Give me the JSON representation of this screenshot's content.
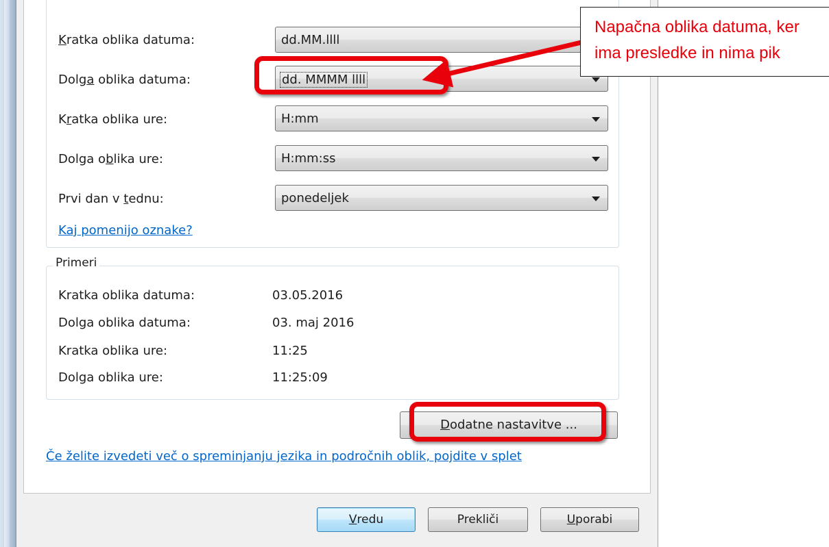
{
  "settings": {
    "rows": [
      {
        "label_pre": "",
        "label_key": "K",
        "label_post": "ratka oblika datuma:",
        "value": "dd.MM.llll"
      },
      {
        "label_pre": "Dolg",
        "label_key": "a",
        "label_post": " oblika datuma:",
        "value": "dd. MMMM llll"
      },
      {
        "label_pre": "K",
        "label_key": "r",
        "label_post": "atka oblika ure:",
        "value": "H:mm"
      },
      {
        "label_pre": "Dolga o",
        "label_key": "b",
        "label_post": "lika ure:",
        "value": "H:mm:ss"
      },
      {
        "label_pre": "Prvi dan v ",
        "label_key": "t",
        "label_post": "ednu:",
        "value": "ponedeljek"
      }
    ],
    "help_link": "Kaj pomenijo oznake?"
  },
  "examples": {
    "legend": "Primeri",
    "rows": [
      {
        "label": "Kratka oblika datuma:",
        "value": "03.05.2016"
      },
      {
        "label": "Dolga oblika datuma:",
        "value": "03. maj 2016"
      },
      {
        "label": "Kratka oblika ure:",
        "value": "11:25"
      },
      {
        "label": "Dolga oblika ure:",
        "value": "11:25:09"
      }
    ]
  },
  "more_settings_button": {
    "key": "D",
    "rest": "odatne nastavitve ..."
  },
  "web_link": "Če želite izvedeti več o spreminjanju jezika in področnih oblik, pojdite v splet",
  "footer": {
    "ok_pre": "V",
    "ok_rest": "redu",
    "cancel": "Prekliči",
    "apply_key": "U",
    "apply_rest": "porabi"
  },
  "annotation": {
    "line1": "Napačna oblika datuma, ker",
    "line2": "ima presledke in nima pik",
    "color": "#e8000b"
  }
}
